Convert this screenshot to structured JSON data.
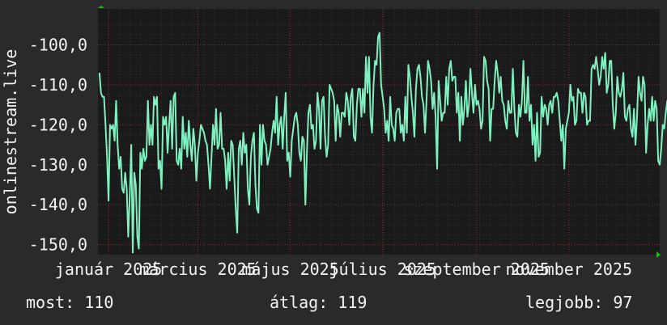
{
  "colors": {
    "background": "#2a2a2a",
    "plot_background": "#1a1a1a",
    "grid": "#7a3a3a",
    "series": "#7ff0c0",
    "axis_arrows": "#00cc00",
    "text": "#f2f2f2"
  },
  "chart_data": {
    "type": "line",
    "title": "",
    "xlabel": "",
    "ylabel": "onlinestream.live",
    "xlim": [
      "2024-12-25",
      "2025-12-31"
    ],
    "ylim": [
      -152.5,
      -91
    ],
    "yticks": [
      -150,
      -140,
      -130,
      -120,
      -110,
      -100
    ],
    "ytick_labels": [
      "-150,0",
      "-140,0",
      "-130,0",
      "-120,0",
      "-110,0",
      "-100,0"
    ],
    "xticks": [
      "2025-01-01",
      "2025-03-01",
      "2025-05-01",
      "2025-07-01",
      "2025-09-01",
      "2025-11-01"
    ],
    "xtick_labels": [
      "január 2025",
      "március 2025",
      "május 2025",
      "július 2025",
      "szeptember 2025",
      "november 2025"
    ],
    "grid": true,
    "series": [
      {
        "name": "",
        "x_start": "2024-12-26",
        "x_step_days": 1,
        "values": [
          -107,
          -112,
          -113,
          -113,
          -120,
          -128,
          -139,
          -120,
          -121,
          -120,
          -124,
          -114,
          -125,
          -131,
          -128,
          -136,
          -137,
          -132,
          -136,
          -148,
          -138,
          -125,
          -152,
          -132,
          -135,
          -148,
          -151,
          -127,
          -131,
          -126,
          -129,
          -128,
          -114,
          -125,
          -120,
          -125,
          -113,
          -115,
          -113,
          -131,
          -129,
          -136,
          -118,
          -120,
          -118,
          -127,
          -120,
          -114,
          -126,
          -113,
          -112,
          -129,
          -130,
          -126,
          -131,
          -118,
          -126,
          -122,
          -128,
          -119,
          -125,
          -129,
          -121,
          -125,
          -134,
          -127,
          -124,
          -120,
          -121,
          -122,
          -124,
          -125,
          -130,
          -136,
          -128,
          -120,
          -125,
          -116,
          -126,
          -125,
          -117,
          -126,
          -126,
          -129,
          -136,
          -127,
          -134,
          -124,
          -125,
          -133,
          -141,
          -147,
          -126,
          -124,
          -130,
          -122,
          -127,
          -125,
          -136,
          -140,
          -128,
          -124,
          -122,
          -135,
          -141,
          -142,
          -120,
          -130,
          -120,
          -124,
          -125,
          -130,
          -128,
          -126,
          -122,
          -119,
          -122,
          -113,
          -125,
          -120,
          -118,
          -126,
          -118,
          -112,
          -129,
          -127,
          -133,
          -124,
          -121,
          -118,
          -117,
          -120,
          -127,
          -129,
          -123,
          -124,
          -140,
          -127,
          -117,
          -115,
          -121,
          -120,
          -126,
          -124,
          -112,
          -116,
          -126,
          -114,
          -113,
          -123,
          -128,
          -125,
          -110,
          -111,
          -112,
          -114,
          -124,
          -115,
          -117,
          -123,
          -117,
          -117,
          -118,
          -112,
          -114,
          -120,
          -113,
          -111,
          -123,
          -124,
          -115,
          -111,
          -111,
          -118,
          -111,
          -117,
          -103,
          -112,
          -103,
          -118,
          -122,
          -110,
          -104,
          -105,
          -98,
          -97,
          -110,
          -113,
          -116,
          -122,
          -119,
          -124,
          -113,
          -120,
          -121,
          -124,
          -117,
          -116,
          -116,
          -122,
          -120,
          -124,
          -113,
          -122,
          -105,
          -108,
          -113,
          -117,
          -123,
          -111,
          -106,
          -105,
          -108,
          -113,
          -115,
          -122,
          -114,
          -104,
          -106,
          -109,
          -116,
          -112,
          -118,
          -131,
          -109,
          -114,
          -119,
          -117,
          -117,
          -108,
          -115,
          -106,
          -104,
          -109,
          -108,
          -108,
          -117,
          -112,
          -124,
          -113,
          -120,
          -116,
          -109,
          -118,
          -115,
          -106,
          -112,
          -117,
          -110,
          -115,
          -114,
          -116,
          -121,
          -119,
          -103,
          -104,
          -109,
          -111,
          -124,
          -116,
          -116,
          -109,
          -104,
          -107,
          -112,
          -108,
          -114,
          -115,
          -119,
          -121,
          -114,
          -117,
          -117,
          -106,
          -116,
          -122,
          -123,
          -115,
          -118,
          -114,
          -104,
          -117,
          -117,
          -108,
          -119,
          -115,
          -125,
          -120,
          -129,
          -117,
          -128,
          -127,
          -113,
          -118,
          -115,
          -116,
          -120,
          -115,
          -114,
          -117,
          -113,
          -113,
          -112,
          -114,
          -119,
          -124,
          -120,
          -131,
          -121,
          -119,
          -117,
          -110,
          -114,
          -113,
          -120,
          -119,
          -111,
          -112,
          -112,
          -117,
          -112,
          -113,
          -120,
          -119,
          -119,
          -106,
          -105,
          -106,
          -103,
          -106,
          -110,
          -108,
          -103,
          -106,
          -102,
          -112,
          -110,
          -104,
          -104,
          -115,
          -121,
          -117,
          -108,
          -112,
          -113,
          -111,
          -107,
          -118,
          -119,
          -116,
          -115,
          -121,
          -123,
          -116,
          -125,
          -118,
          -108,
          -112,
          -114,
          -108,
          -110,
          -127,
          -120,
          -116,
          -119,
          -113,
          -119,
          -114,
          -116,
          -129,
          -130,
          -126,
          -120,
          -121,
          -117,
          -114,
          -115,
          -130,
          -133,
          -120,
          -122,
          -118,
          -120,
          -111,
          -114,
          -120,
          -110,
          -110
        ]
      }
    ]
  },
  "stats": {
    "current": "most: 110",
    "average": "átlag: 119",
    "best": "legjobb: 97"
  }
}
